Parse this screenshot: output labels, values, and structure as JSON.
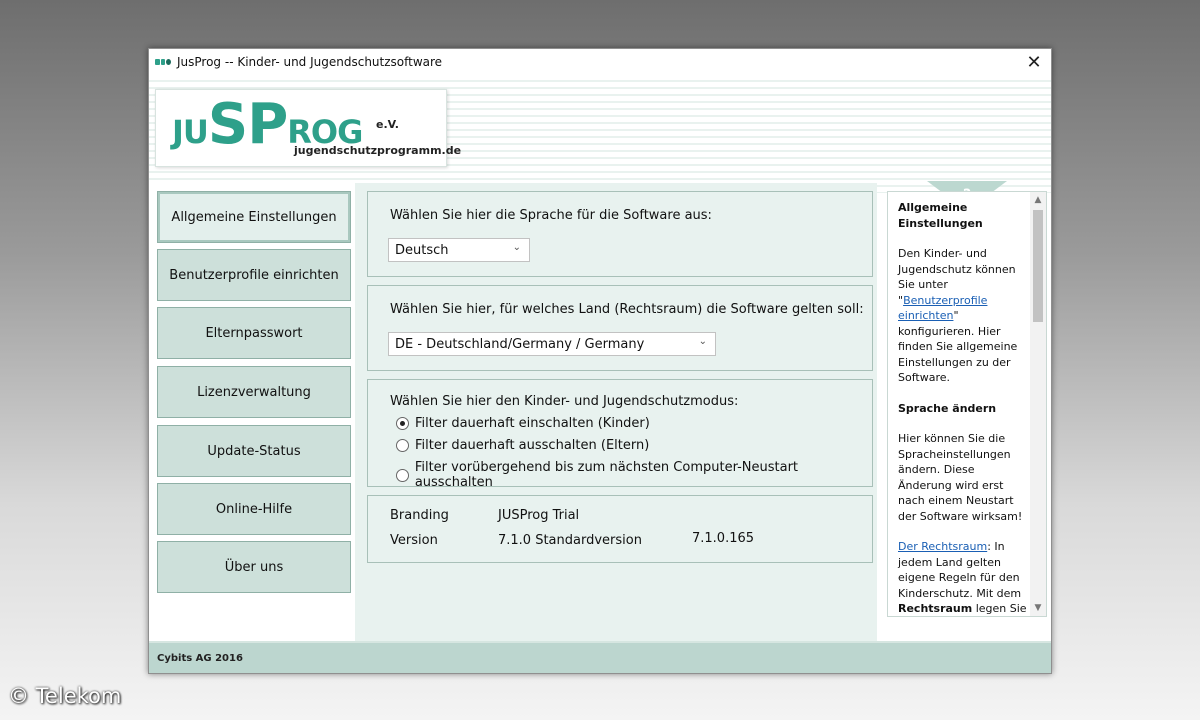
{
  "window": {
    "title": "JusProg -- Kinder- und Jugendschutzsoftware",
    "close_glyph": "✕"
  },
  "logo": {
    "part_ju": "JU",
    "part_s": "S",
    "part_p": "P",
    "part_rog": "ROG",
    "ev": "e.V.",
    "subtitle": "jugendschutzprogramm.de"
  },
  "sidebar": {
    "items": [
      {
        "label": "Allgemeine Einstellungen",
        "active": true
      },
      {
        "label": "Benutzerprofile einrichten"
      },
      {
        "label": "Elternpasswort"
      },
      {
        "label": "Lizenzverwaltung"
      },
      {
        "label": "Update-Status"
      },
      {
        "label": "Online-Hilfe"
      },
      {
        "label": "Über uns"
      }
    ]
  },
  "language": {
    "label": "Wählen Sie hier die Sprache für die Software aus:",
    "selected": "Deutsch"
  },
  "country": {
    "label": "Wählen Sie hier, für welches Land (Rechtsraum) die Software gelten soll:",
    "selected": "DE - Deutschland/Germany / Germany"
  },
  "mode": {
    "label": "Wählen Sie hier den Kinder- und Jugendschutzmodus:",
    "options": [
      {
        "label": "Filter dauerhaft einschalten (Kinder)",
        "checked": true
      },
      {
        "label": "Filter dauerhaft ausschalten (Eltern)",
        "checked": false
      },
      {
        "label": "Filter vorübergehend bis zum nächsten Computer-Neustart ausschalten",
        "checked": false
      }
    ]
  },
  "info": {
    "branding_label": "Branding",
    "branding_value": "JUSProg Trial",
    "version_label": "Version",
    "version_value": "7.1.0 Standardversion",
    "build": "7.1.0.165"
  },
  "help": {
    "question_glyph": "?",
    "title": "Allgemeine Einstellungen",
    "p1_a": "Den Kinder- und Jugendschutz können Sie unter ",
    "p1_quote_open": "\"",
    "p1_link": "Benutzerprofile einrichten",
    "p1_b": "\" konfigurieren. Hier finden Sie allgemeine Einstellungen zu der Software.",
    "h2": "Sprache ändern",
    "p2": "Hier können Sie die Spracheinstellungen ändern. Diese Änderung wird erst nach einem Neustart der Software wirksam!",
    "p3_link": "Der Rechtsraum",
    "p3_a": ": In jedem Land gelten eigene Regeln für den Kinderschutz. Mit dem ",
    "p3_bold": "Rechtsraum",
    "p3_b": " legen Sie"
  },
  "footer": {
    "text": "Cybits AG 2016"
  },
  "watermark": {
    "text": "© Telekom"
  },
  "colors": {
    "brand_green": "#2ea08a",
    "nav_bg": "#cde0da",
    "content_bg": "#e8f2ef",
    "footer_bg": "#bcd6cf",
    "link": "#1a5fb4"
  }
}
